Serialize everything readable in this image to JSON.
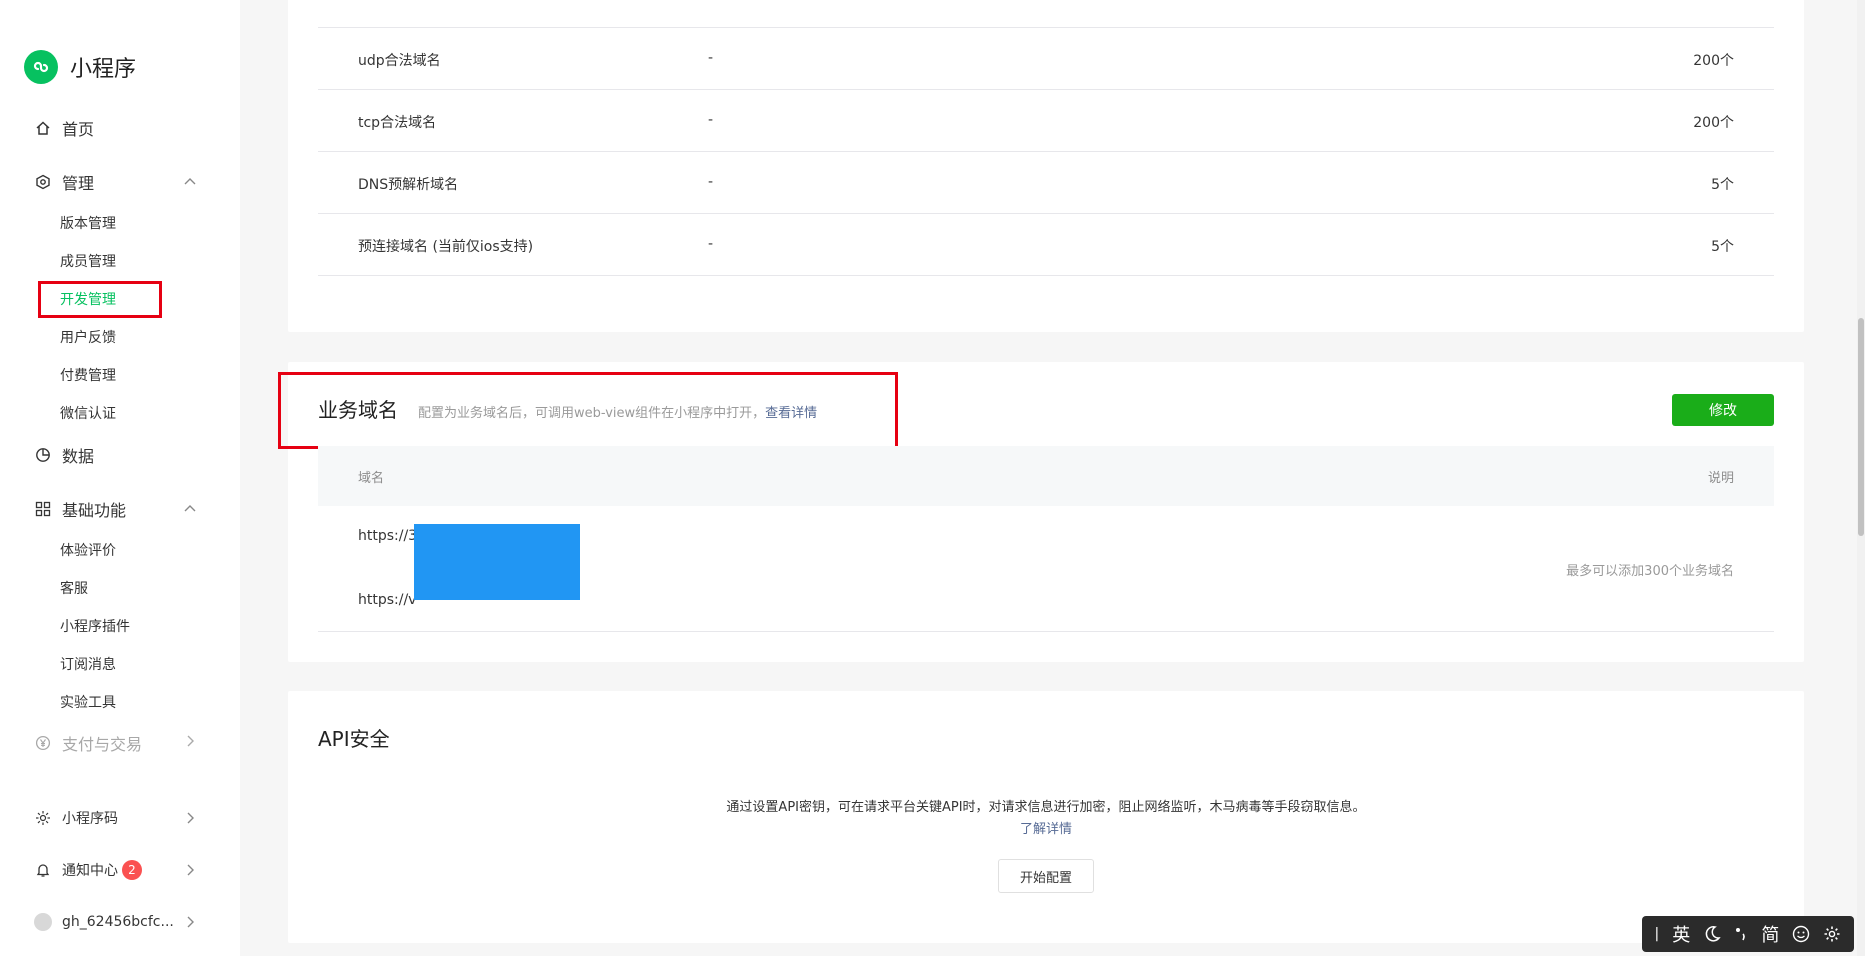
{
  "app": {
    "name": "小程序"
  },
  "sidebar": {
    "home": "首页",
    "manage": "管理",
    "manage_items": [
      "版本管理",
      "成员管理",
      "开发管理",
      "用户反馈",
      "付费管理",
      "微信认证"
    ],
    "data": "数据",
    "basic": "基础功能",
    "basic_items": [
      "体验评价",
      "客服",
      "小程序插件",
      "订阅消息",
      "实验工具"
    ],
    "payment": "支付与交易",
    "qrcode": "小程序码",
    "notify": "通知中心",
    "notify_count": "2",
    "account": "gh_62456bcfc..."
  },
  "server_domains": {
    "rows": [
      {
        "name": "udp合法域名",
        "value": "-",
        "limit": "200个"
      },
      {
        "name": "tcp合法域名",
        "value": "-",
        "limit": "200个"
      },
      {
        "name": "DNS预解析域名",
        "value": "-",
        "limit": "5个"
      },
      {
        "name": "预连接域名 (当前仅ios支持)",
        "value": "-",
        "limit": "5个"
      }
    ]
  },
  "business_domain": {
    "title": "业务域名",
    "desc": "配置为业务域名后，可调用web-view组件在小程序中打开，",
    "link": "查看详情",
    "edit_button": "修改",
    "col_domain": "域名",
    "col_note": "说明",
    "domains": [
      "https://3",
      "https://v"
    ],
    "note": "最多可以添加300个业务域名"
  },
  "api_security": {
    "title": "API安全",
    "desc": "通过设置API密钥，可在请求平台关键API时，对请求信息进行加密，阻止网络监听，木马病毒等手段窃取信息。",
    "link": "了解详情",
    "button": "开始配置"
  },
  "ime": {
    "lang": "英",
    "mode": "简"
  },
  "colors": {
    "accent": "#07c160",
    "button": "#1aad19",
    "highlight": "#e60012",
    "redact": "#2196f3"
  }
}
